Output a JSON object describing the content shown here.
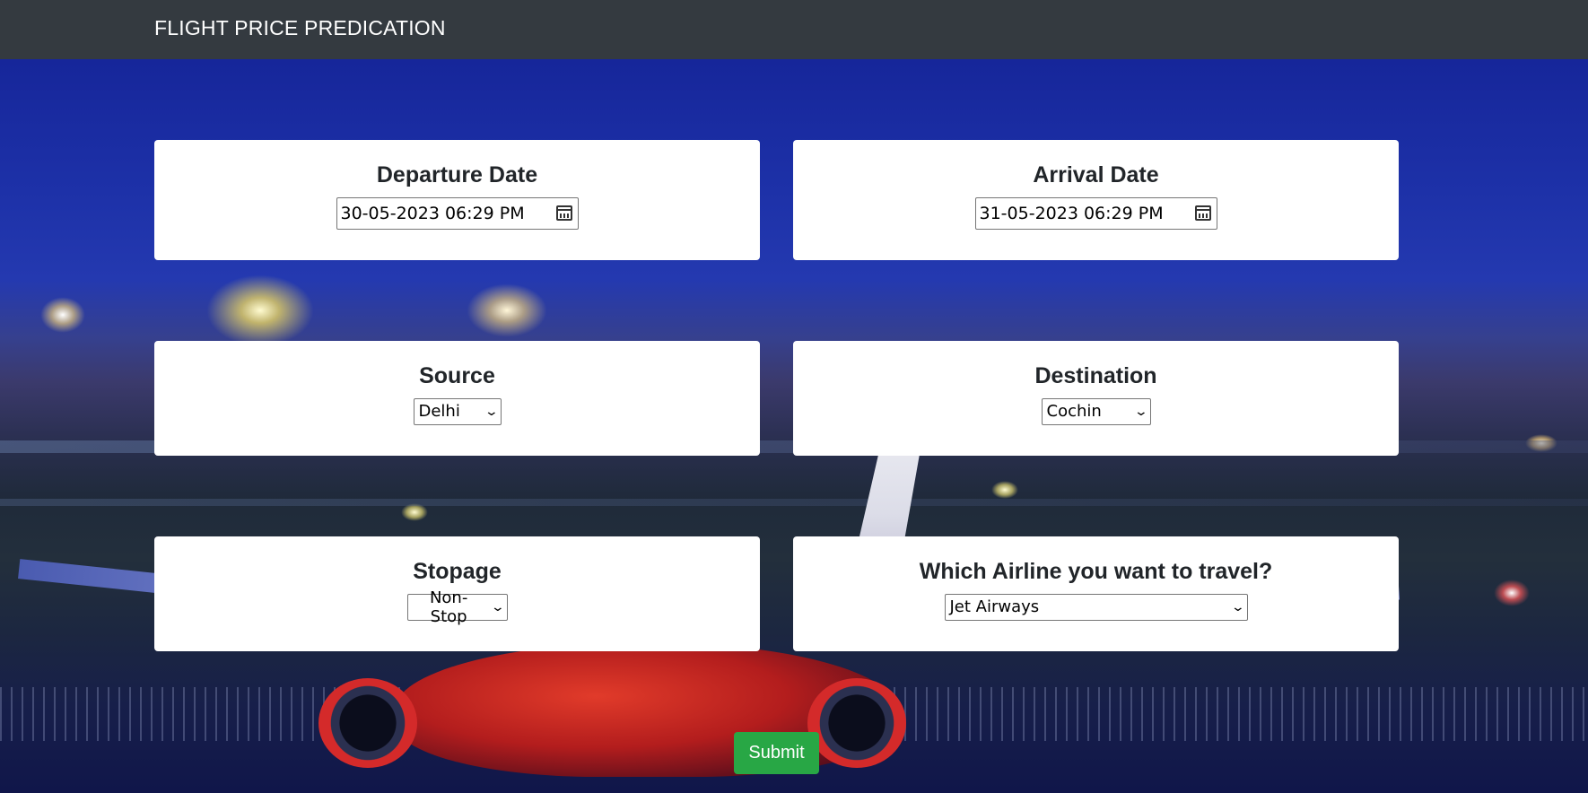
{
  "navbar": {
    "title": "FLIGHT PRICE PREDICATION"
  },
  "departure": {
    "label": "Departure Date",
    "value": "30-05-2023 06:29 PM"
  },
  "arrival": {
    "label": "Arrival Date",
    "value": "31-05-2023 06:29 PM"
  },
  "source": {
    "label": "Source",
    "selected": "Delhi"
  },
  "destination": {
    "label": "Destination",
    "selected": "Cochin"
  },
  "stopage": {
    "label": "Stopage",
    "selected": "Non-Stop"
  },
  "airline": {
    "label": "Which Airline you want to travel?",
    "selected": "Jet Airways"
  },
  "submit": {
    "label": "Submit"
  },
  "icons": {
    "date_picker": "calendar-icon",
    "dropdown": "chevron-down-icon"
  },
  "colors": {
    "navbar": "#343a40",
    "submit": "#28a745",
    "card": "#ffffff"
  }
}
